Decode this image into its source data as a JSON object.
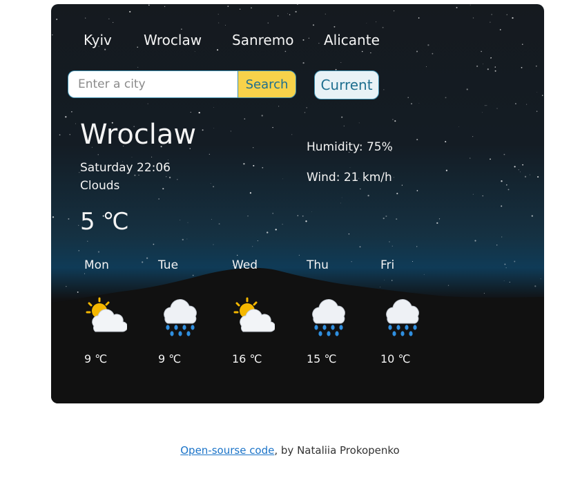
{
  "nav": {
    "cities": [
      "Kyiv",
      "Wroclaw",
      "Sanremo",
      "Alicante"
    ]
  },
  "search": {
    "placeholder": "Enter a city",
    "value": "",
    "button_label": "Search",
    "current_label": "Current"
  },
  "weather": {
    "city": "Wroclaw",
    "datetime": "Saturday 22:06",
    "description": "Clouds",
    "temperature": "5 ℃",
    "humidity": "Humidity: 75%",
    "wind": "Wind: 21 km/h"
  },
  "forecast": [
    {
      "day": "Mon",
      "icon": "sun-behind-cloud-icon",
      "temp": "9 ℃"
    },
    {
      "day": "Tue",
      "icon": "cloud-with-rain-icon",
      "temp": "9 ℃"
    },
    {
      "day": "Wed",
      "icon": "sun-behind-cloud-icon",
      "temp": "16 ℃"
    },
    {
      "day": "Thu",
      "icon": "cloud-with-rain-icon",
      "temp": "15 ℃"
    },
    {
      "day": "Fri",
      "icon": "cloud-with-rain-icon",
      "temp": "10 ℃"
    }
  ],
  "footer": {
    "link_text": "Open-sourse code",
    "suffix": ", by Nataliia Prokopenko"
  },
  "colors": {
    "accent": "#1e6f8f",
    "search_button": "#f7d24a",
    "link": "#1a73c8"
  }
}
